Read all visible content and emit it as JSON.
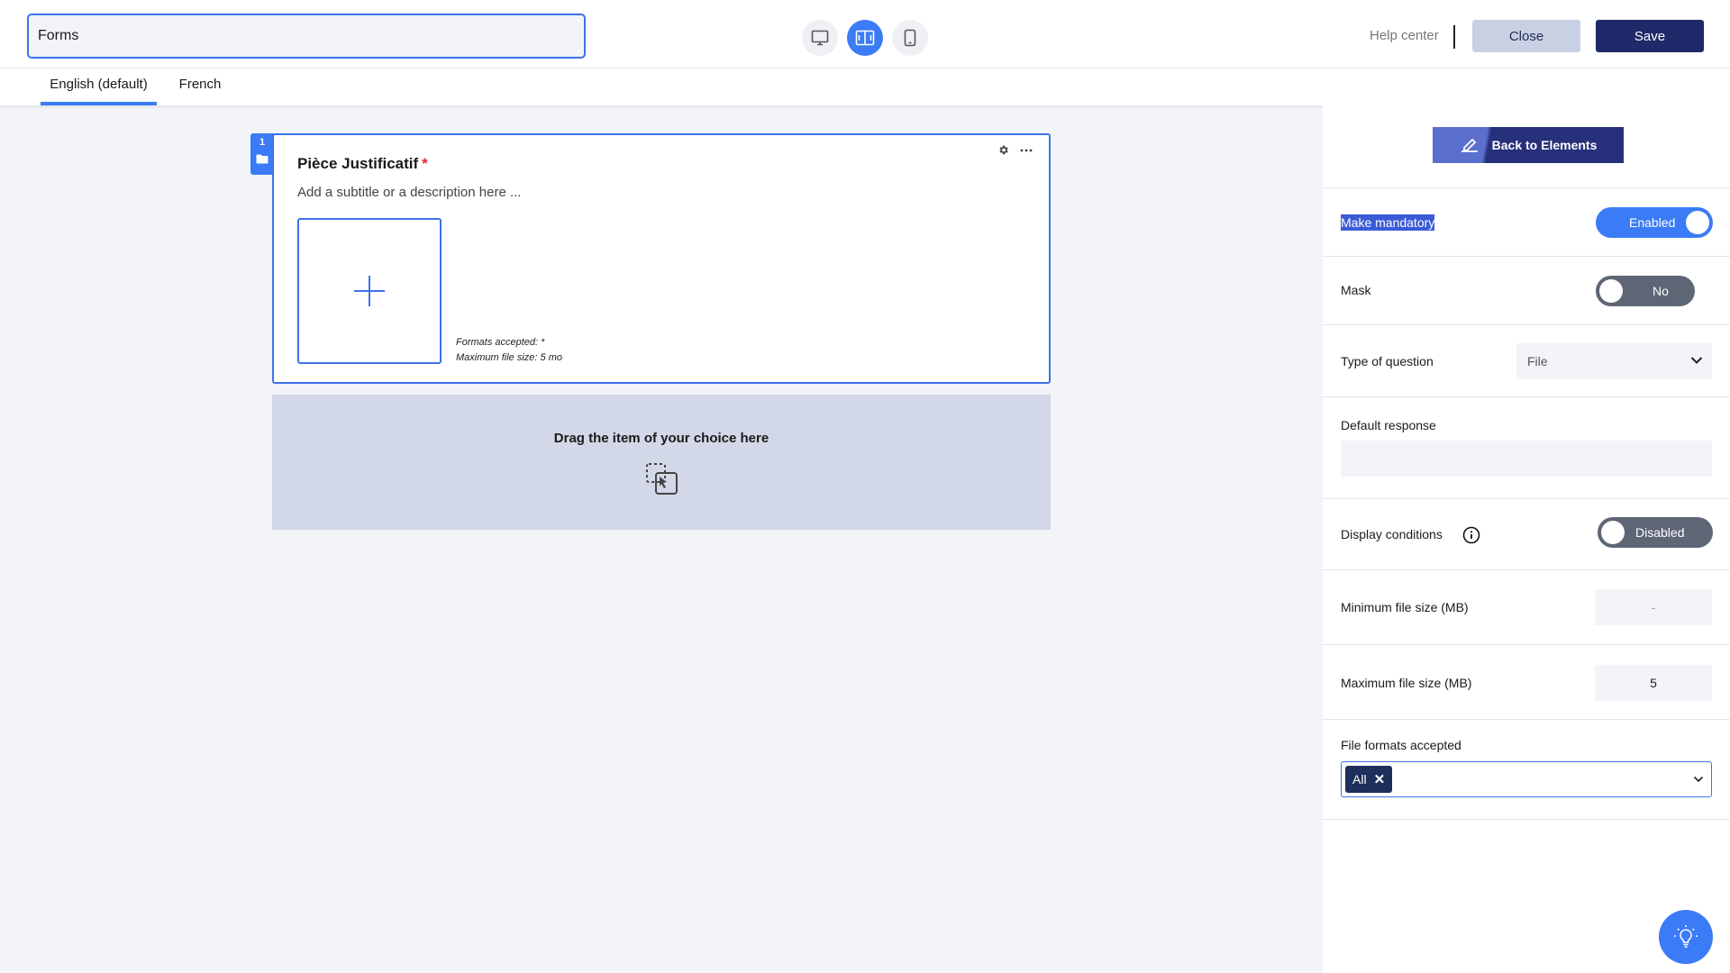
{
  "header": {
    "form_title": "Forms",
    "help_label": "Help center",
    "close_label": "Close",
    "save_label": "Save"
  },
  "languages": [
    {
      "label": "English (default)",
      "active": true
    },
    {
      "label": "French",
      "active": false
    }
  ],
  "question": {
    "number": "1",
    "title": "Pièce Justificatif",
    "required_mark": "*",
    "subtitle_placeholder": "Add a subtitle or a description here ...",
    "formats_text": "Formats accepted: *",
    "max_size_text": "Maximum file size: 5 mo"
  },
  "drop_zone": {
    "text": "Drag the item of your choice here"
  },
  "panel": {
    "back_label": "Back to Elements",
    "mandatory": {
      "label": "Make mandatory",
      "value": "Enabled"
    },
    "mask": {
      "label": "Mask",
      "value": "No"
    },
    "question_type": {
      "label": "Type of question",
      "value": "File"
    },
    "default_response": {
      "label": "Default response",
      "value": ""
    },
    "display_conditions": {
      "label": "Display conditions",
      "value": "Disabled"
    },
    "min_size": {
      "label": "Minimum file size (MB)",
      "value": "-"
    },
    "max_size": {
      "label": "Maximum file size (MB)",
      "value": "5"
    },
    "formats": {
      "label": "File formats accepted",
      "chips": [
        "All"
      ]
    }
  },
  "colors": {
    "accent": "#3b7bf5",
    "primary_dark": "#1f2a6a",
    "required": "#e02b2b",
    "toggle_off": "#5e6676"
  },
  "icons": [
    "desktop-icon",
    "split-view-icon",
    "mobile-icon",
    "folder-icon",
    "gear-icon",
    "more-icon",
    "plus-icon",
    "drag-drop-icon",
    "edit-icon",
    "info-icon",
    "chevron-down-icon",
    "lightbulb-icon"
  ]
}
